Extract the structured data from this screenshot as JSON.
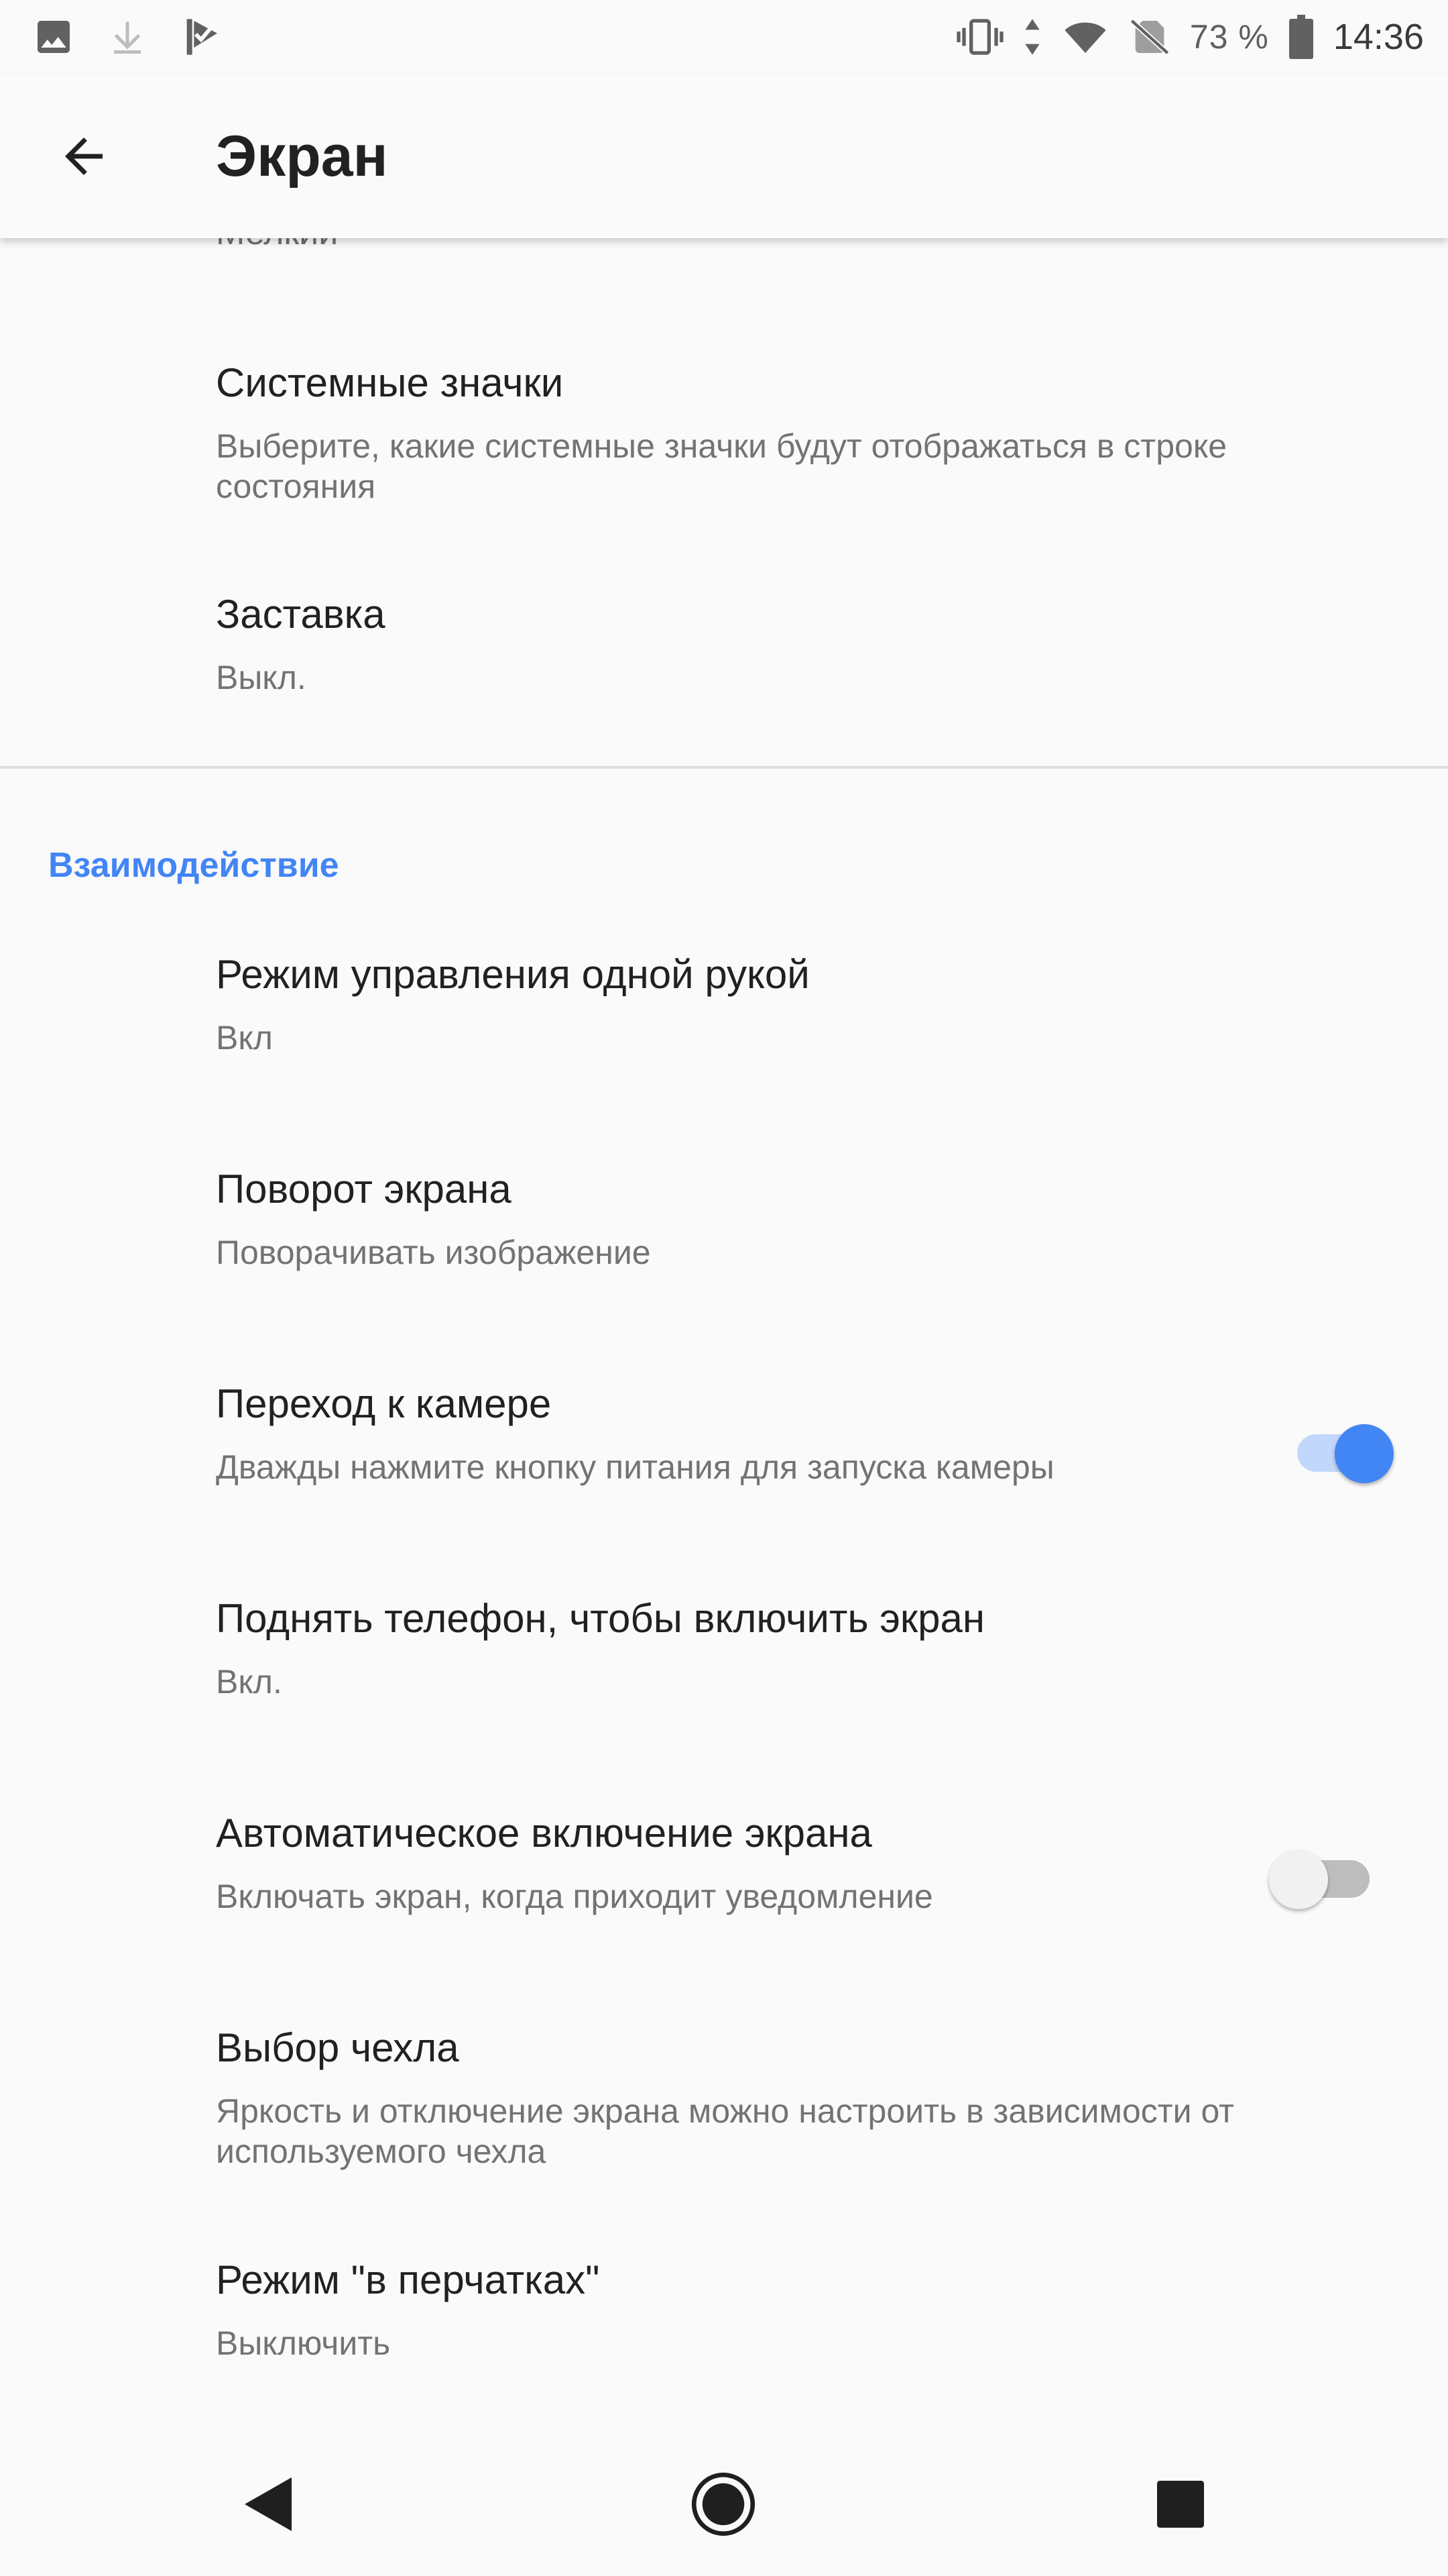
{
  "status_bar": {
    "battery_percent": "73 %",
    "time": "14:36",
    "left_icons": [
      "image-icon",
      "download-icon",
      "checkmark-flag-icon"
    ],
    "right_icons": [
      "vibrate-icon",
      "data-arrows-icon",
      "wifi-icon",
      "no-sim-icon",
      "battery-icon"
    ]
  },
  "app_bar": {
    "title": "Экран",
    "back_icon": "arrow-back-icon"
  },
  "content": {
    "cut_off_text": "Мелкий",
    "items_top": [
      {
        "title": "Системные значки",
        "summary": "Выберите, какие системные значки будут отображаться в строке состояния"
      },
      {
        "title": "Заставка",
        "summary": "Выкл."
      }
    ],
    "category": "Взаимодействие",
    "items": [
      {
        "title": "Режим управления одной рукой",
        "summary": "Вкл"
      },
      {
        "title": "Поворот экрана",
        "summary": "Поворачивать изображение"
      },
      {
        "title": "Переход к камере",
        "summary": "Дважды нажмите кнопку питания для запуска камеры",
        "switch_on": true
      },
      {
        "title": "Поднять телефон, чтобы включить экран",
        "summary": "Вкл."
      },
      {
        "title": "Автоматическое включение экрана",
        "summary": "Включать экран, когда приходит уведомление",
        "switch_on": false
      },
      {
        "title": "Выбор чехла",
        "summary": "Яркость и отключение экрана можно настроить в зависимости от используемого чехла"
      },
      {
        "title": "Режим \"в перчатках\"",
        "summary": "Выключить"
      }
    ]
  },
  "nav_bar": {
    "icons": [
      "back-triangle-icon",
      "home-circle-icon",
      "recents-square-icon"
    ]
  },
  "colors": {
    "accent": "#4285f4",
    "background": "#fafafa",
    "title_text": "#212121",
    "summary_text": "#737373"
  }
}
